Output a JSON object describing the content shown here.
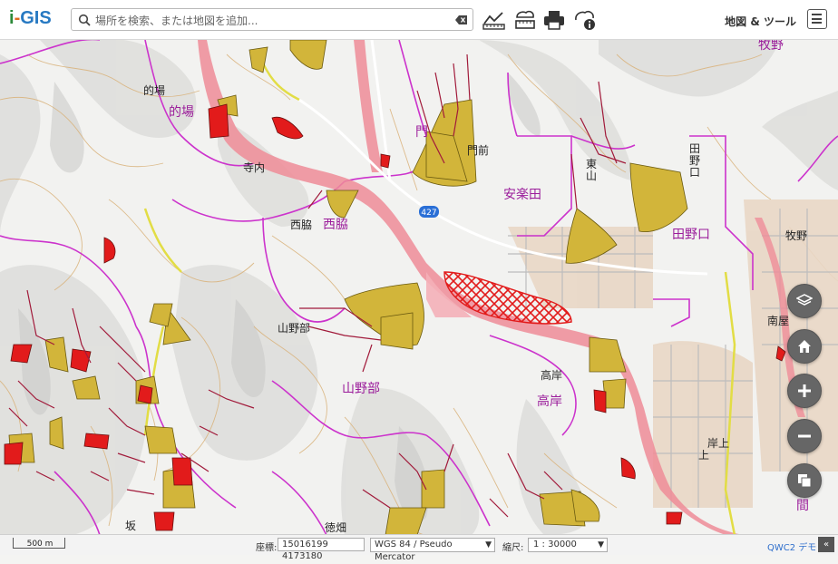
{
  "app": {
    "logo_i": "i",
    "logo_dash": "-",
    "logo_gis": "GIS"
  },
  "search": {
    "placeholder": "場所を検索、または地図を追加..."
  },
  "toolbar": {
    "menu_label": "地図 & ツール"
  },
  "map_labels": {
    "matoba_black": "的場",
    "matoba_purple": "的場",
    "terauchi": "寺内",
    "nishiwaki_black": "西脇",
    "nishiwaki_purple": "西脇",
    "yamanobe_black": "山野部",
    "yamanobe_purple": "山野部",
    "monzen_a": "門",
    "monzen_b": "門前",
    "arakuda": "安楽田",
    "higashiyama": "東\n山",
    "tanoguchi": "田野口",
    "tano": "田\n野\n口",
    "makino_top": "牧野",
    "makino_right": "牧野",
    "takagishi_black": "高岸",
    "takagishi_purple": "高岸",
    "kishikami": "岸上",
    "kami": "上",
    "saka": "坂",
    "tokuhata": "徳畑",
    "mamaya": "間",
    "minamiya": "南屋",
    "route_shield": "427"
  },
  "footer": {
    "scale_text": "500 m",
    "coord_label": "座標:",
    "coord_value": "15016199 4173180",
    "crs": "WGS 84 / Pseudo Mercator",
    "scale_label": "縮尺:",
    "scale_value": "1 : 30000",
    "qwc": "QWC2 デモ"
  },
  "colors": {
    "hazard_yellow": "#d2b53a",
    "hazard_red": "#e21b1b",
    "admin_boundary": "#cc33cc",
    "river": "#e86a78",
    "contour": "#d9b27a"
  },
  "icons": {
    "search": "search-icon",
    "clear": "clear-icon",
    "measure": "measure-icon",
    "print_area": "print-area-icon",
    "print": "printer-icon",
    "info": "info-icon",
    "layers": "layers-icon",
    "home": "home-icon",
    "zoom_in": "zoom-in-icon",
    "zoom_out": "zoom-out-icon",
    "basemap": "basemap-icon"
  }
}
